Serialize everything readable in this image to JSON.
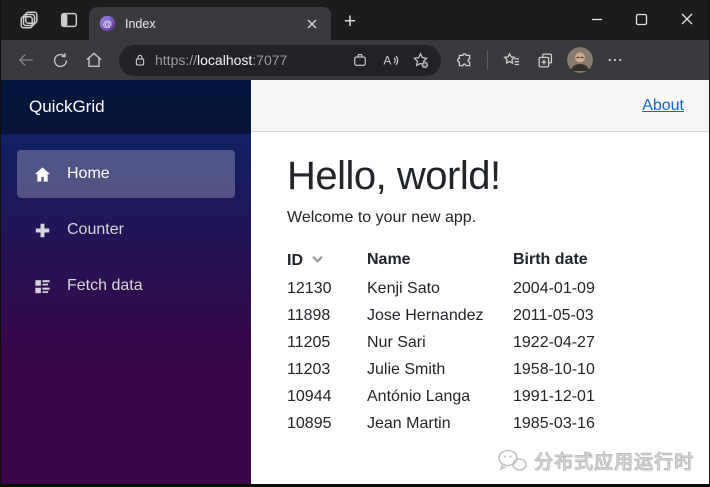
{
  "browser": {
    "tab": {
      "title": "Index"
    },
    "url": {
      "scheme": "https://",
      "host": "localhost",
      "port": ":7077"
    },
    "colors": {
      "titlebar": "#1c1c1f",
      "toolbar": "#3a3a3e",
      "addressbar": "#212126"
    }
  },
  "sidebar": {
    "brand": "QuickGrid",
    "items": [
      {
        "label": "Home",
        "icon": "home-icon",
        "active": true
      },
      {
        "label": "Counter",
        "icon": "plus-icon",
        "active": false
      },
      {
        "label": "Fetch data",
        "icon": "list-icon",
        "active": false
      }
    ],
    "gradient": [
      "#052767",
      "#3a0647"
    ]
  },
  "topbar": {
    "about_label": "About",
    "link_color": "#1268c3"
  },
  "main": {
    "heading": "Hello, world!",
    "subheading": "Welcome to your new app.",
    "table": {
      "columns": [
        "ID",
        "Name",
        "Birth date"
      ],
      "sorted_column": "ID",
      "sort_direction": "descending",
      "rows": [
        [
          "12130",
          "Kenji Sato",
          "2004-01-09"
        ],
        [
          "11898",
          "Jose Hernandez",
          "2011-05-03"
        ],
        [
          "11205",
          "Nur Sari",
          "1922-04-27"
        ],
        [
          "11203",
          "Julie Smith",
          "1958-10-10"
        ],
        [
          "10944",
          "António Langa",
          "1991-12-01"
        ],
        [
          "10895",
          "Jean Martin",
          "1985-03-16"
        ]
      ]
    }
  },
  "watermark": {
    "text": "分布式应用运行时"
  }
}
